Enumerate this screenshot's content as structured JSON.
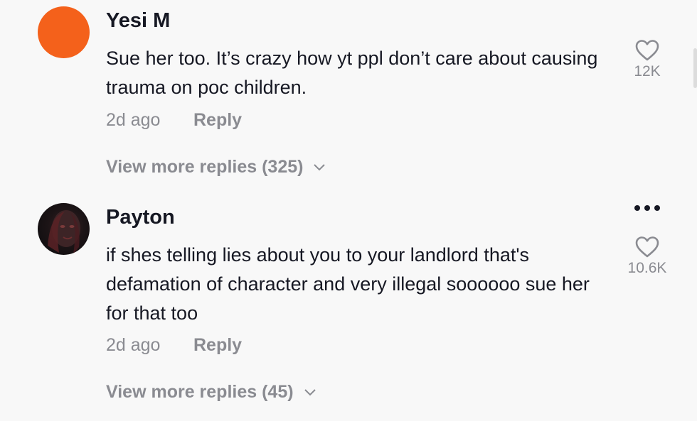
{
  "comments": [
    {
      "username": "Yesi M",
      "text": "Sue her too. It’s crazy how yt ppl don’t care about causing trauma on poc children.",
      "time": "2d ago",
      "reply_label": "Reply",
      "likes": "12K",
      "view_more": "View more replies (325)",
      "avatar_color": "#f4611b"
    },
    {
      "username": "Payton",
      "text": "if shes telling lies about you to your landlord that's defamation of character and very illegal soooooo sue her for that too",
      "time": "2d ago",
      "reply_label": "Reply",
      "likes": "10.6K",
      "view_more": "View more replies (45)"
    }
  ],
  "icons": {
    "like": "heart-outline-icon",
    "more": "more-options-icon",
    "expand": "chevron-down-icon"
  },
  "colors": {
    "background": "#f8f8f8",
    "primary_text": "#161823",
    "secondary_text": "#8a8b91"
  }
}
